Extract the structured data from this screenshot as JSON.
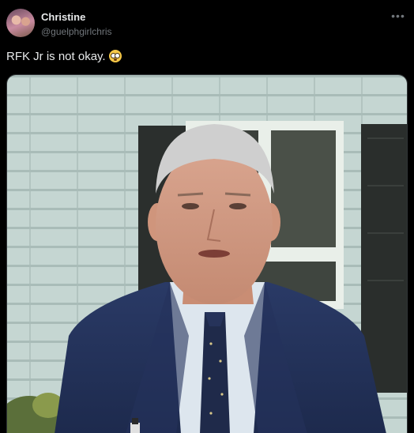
{
  "post": {
    "author_name": "Christine",
    "author_handle": "@guelphgirlchris",
    "text": "RFK Jr is not okay.",
    "emoji": "flushed-face-emoji"
  },
  "icons": {
    "more": "more-options-icon"
  },
  "colors": {
    "background": "#000000",
    "text_primary": "#e7e9ea",
    "text_secondary": "#71767b"
  }
}
